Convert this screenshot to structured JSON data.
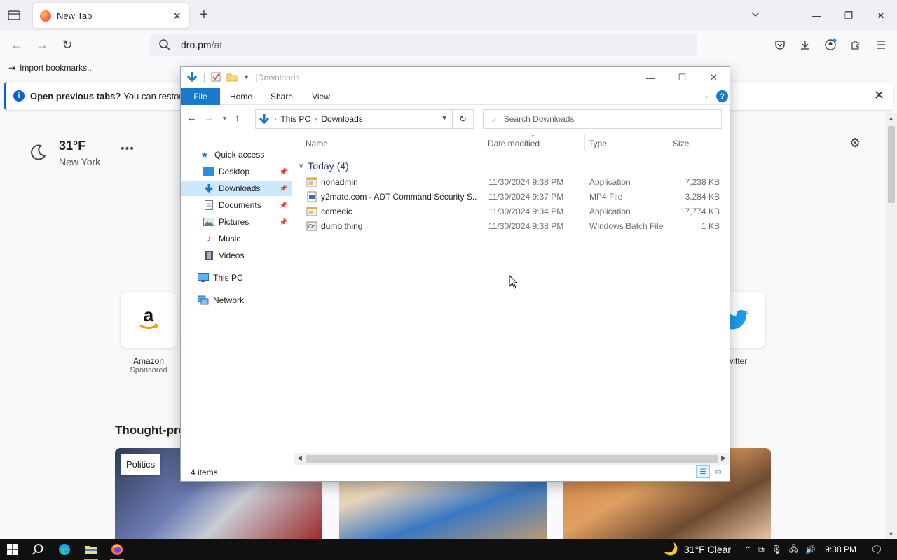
{
  "browser": {
    "tab_title": "New Tab",
    "url_host": "dro.pm",
    "url_path": "/at",
    "bookmark_import": "Import bookmarks...",
    "infobar_bold": "Open previous tabs?",
    "infobar_text": "You can restore your"
  },
  "newtab": {
    "weather_temp": "31°F",
    "weather_city": "New York",
    "shortcuts": [
      {
        "name": "Amazon",
        "sub": "Sponsored"
      },
      {
        "name": "witter",
        "sub": ""
      }
    ],
    "section_title": "Thought-pro",
    "card_tag": "Politics"
  },
  "explorer": {
    "title": "Downloads",
    "ribbon_tabs": [
      "File",
      "Home",
      "Share",
      "View"
    ],
    "breadcrumb": [
      "This PC",
      "Downloads"
    ],
    "search_placeholder": "Search Downloads",
    "nav": {
      "quick_access": "Quick access",
      "desktop": "Desktop",
      "downloads": "Downloads",
      "documents": "Documents",
      "pictures": "Pictures",
      "music": "Music",
      "videos": "Videos",
      "this_pc": "This PC",
      "network": "Network"
    },
    "columns": [
      "Name",
      "Date modified",
      "Type",
      "Size"
    ],
    "group": "Today (4)",
    "files": [
      {
        "name": "nonadmin",
        "date": "11/30/2024 9:38 PM",
        "type": "Application",
        "size": "7,238 KB",
        "icon": "application-icon"
      },
      {
        "name": "y2mate.com - ADT Command Security S...",
        "date": "11/30/2024 9:37 PM",
        "type": "MP4 File",
        "size": "3,284 KB",
        "icon": "video-file-icon"
      },
      {
        "name": "comedic",
        "date": "11/30/2024 9:34 PM",
        "type": "Application",
        "size": "17,774 KB",
        "icon": "application-icon"
      },
      {
        "name": "dumb thing",
        "date": "11/30/2024 9:38 PM",
        "type": "Windows Batch File",
        "size": "1 KB",
        "icon": "batch-file-icon"
      }
    ],
    "status_count": "4 items"
  },
  "taskbar": {
    "weather": "31°F  Clear",
    "clock": "9:38 PM"
  },
  "colors": {
    "accent_blue": "#1979ca",
    "selection": "#cce8ff",
    "firefox_blue": "#0060df"
  }
}
